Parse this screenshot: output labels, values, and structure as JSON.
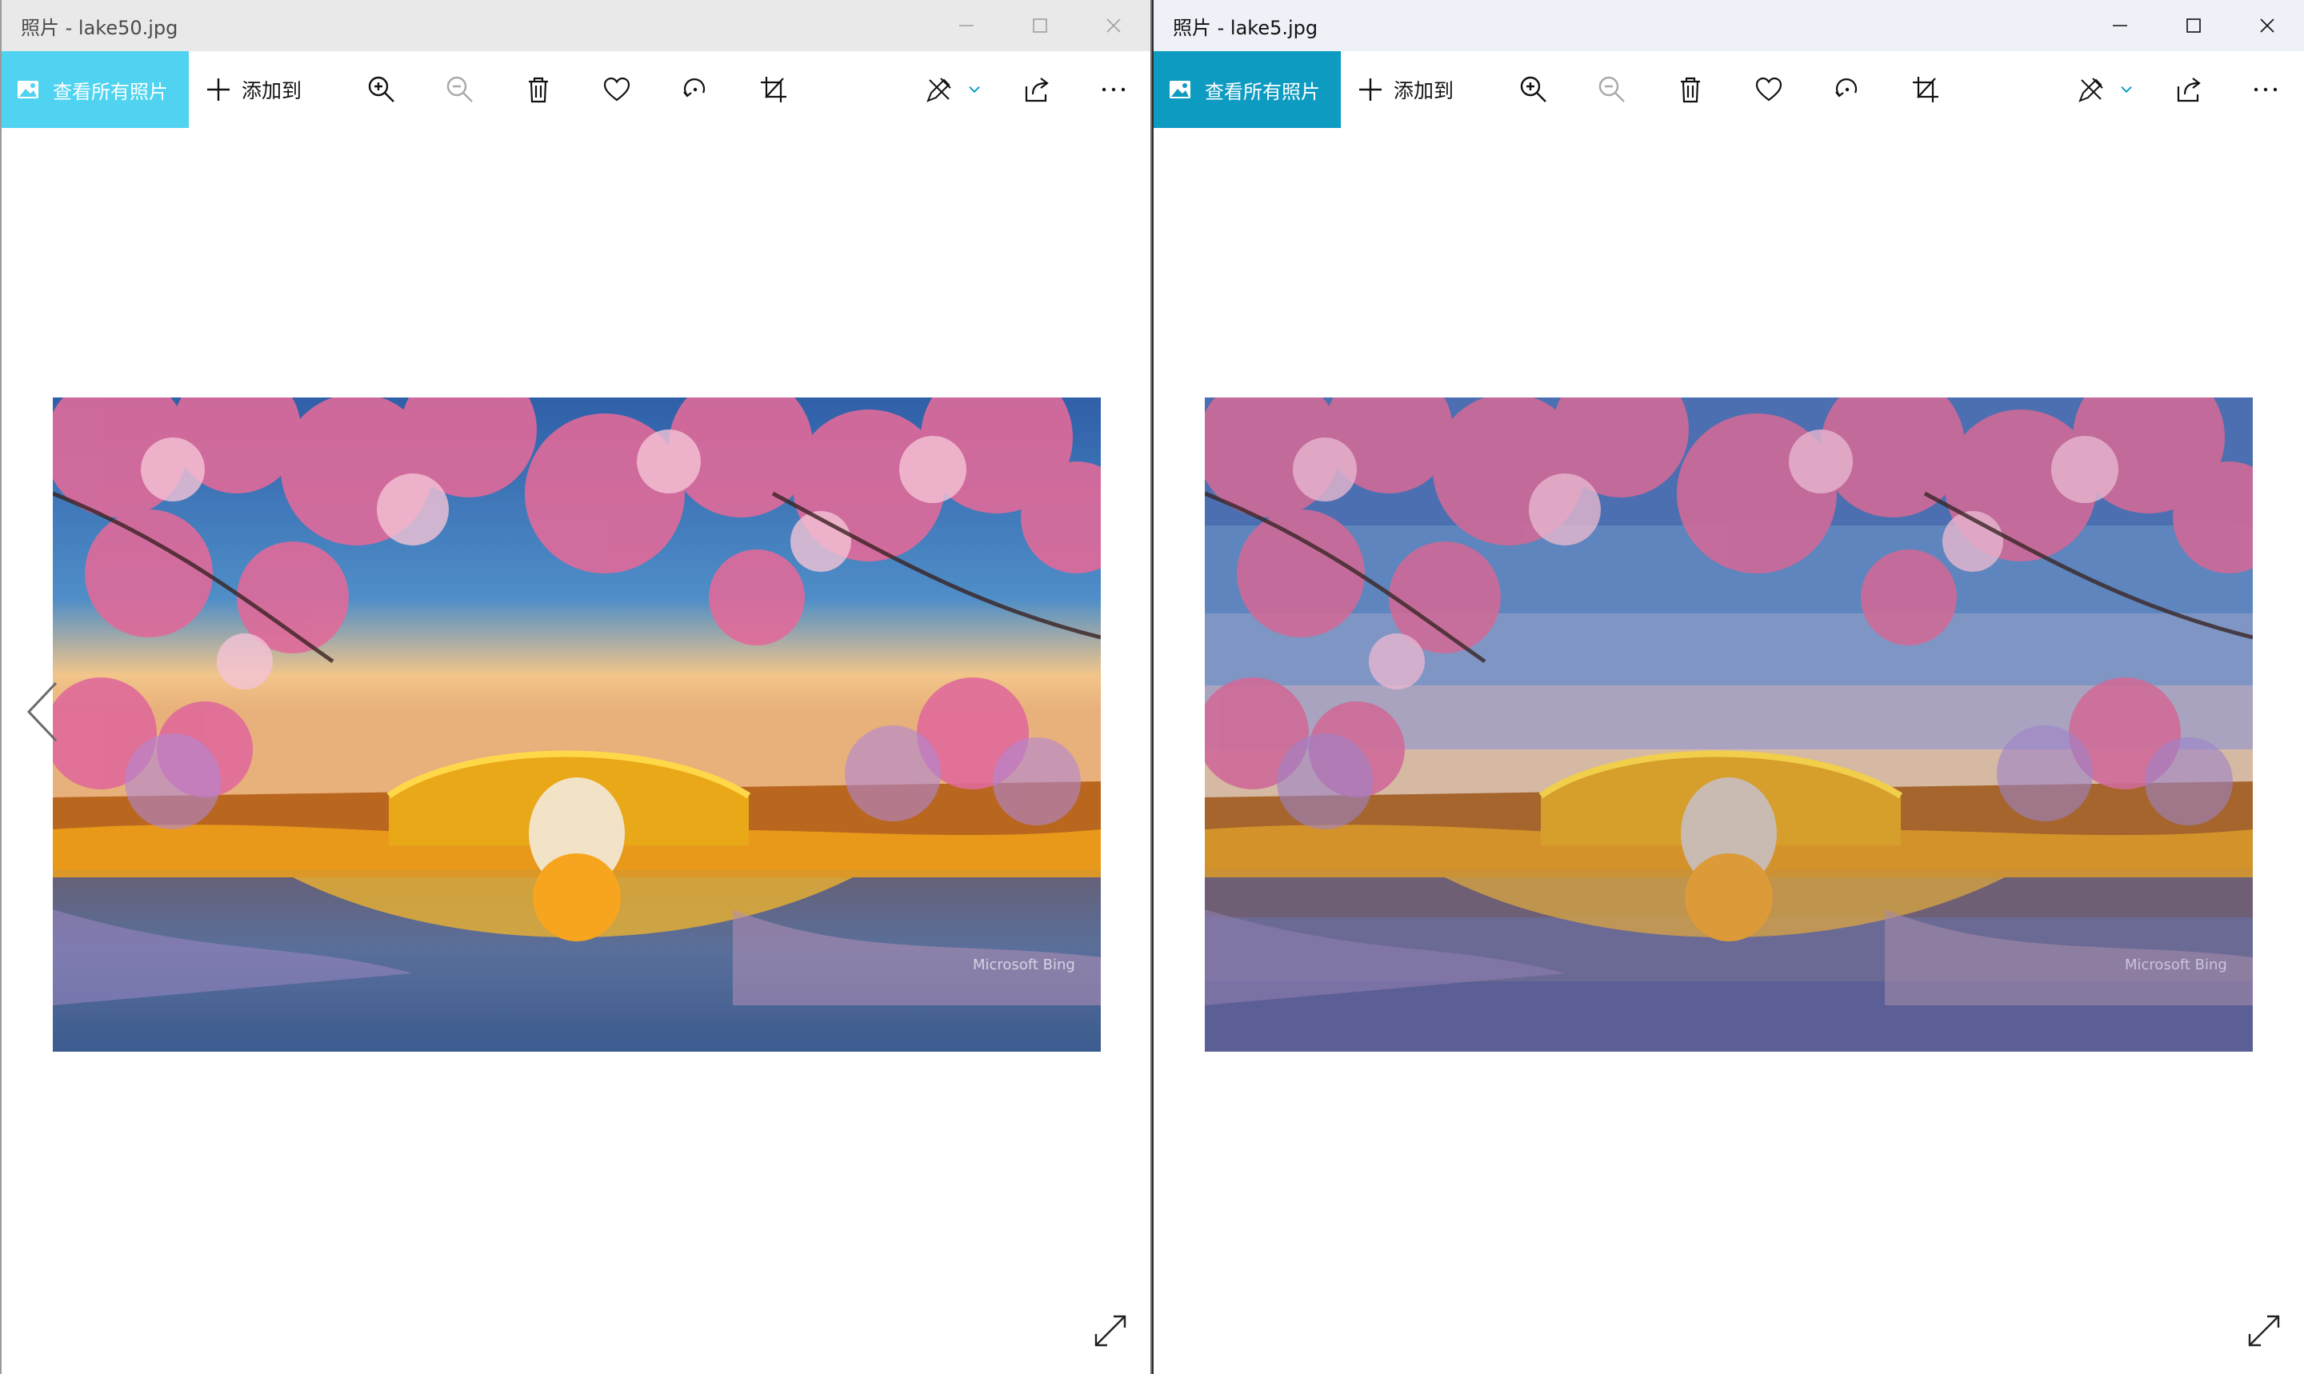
{
  "app": "照片",
  "left_window": {
    "title": "照片 - lake50.jpg",
    "active": false,
    "toolbar": {
      "view_all_label": "查看所有照片",
      "add_to_label": "添加到",
      "icons": [
        "zoom-in-icon",
        "zoom-out-icon",
        "delete-icon",
        "favorite-heart-icon",
        "rotate-icon",
        "crop-icon",
        "edit-draw-icon",
        "share-icon",
        "more-icon"
      ]
    },
    "image": {
      "filename": "lake50.jpg",
      "watermark": "Microsoft Bing",
      "quality": "smooth"
    },
    "has_prev_arrow": true
  },
  "right_window": {
    "title": "照片 - lake5.jpg",
    "active": true,
    "toolbar": {
      "view_all_label": "查看所有照片",
      "add_to_label": "添加到",
      "icons": [
        "zoom-in-icon",
        "zoom-out-icon",
        "delete-icon",
        "favorite-heart-icon",
        "rotate-icon",
        "crop-icon",
        "edit-draw-icon",
        "share-icon",
        "more-icon"
      ]
    },
    "image": {
      "filename": "lake5.jpg",
      "watermark": "Microsoft Bing",
      "quality": "posterized"
    },
    "has_prev_arrow": false
  },
  "colors": {
    "accent_inactive": "#4fd3f0",
    "accent_active": "#0e9bc2",
    "blossom": "#e06a9a",
    "sky": "#3f7fc0",
    "bridge_light": "#f5b21d"
  }
}
